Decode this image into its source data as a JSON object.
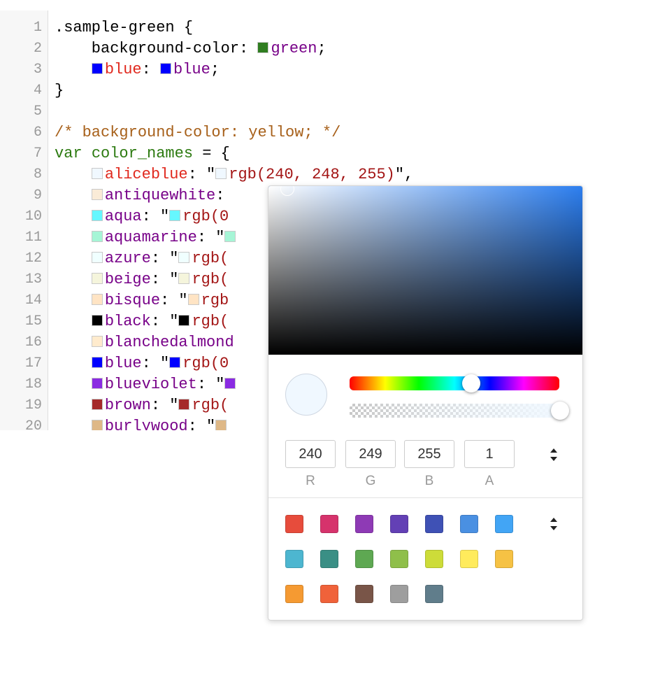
{
  "editor": {
    "lines": [
      {
        "n": "1",
        "toks": [
          {
            "t": ".sample-green",
            "c": "sel"
          },
          {
            "t": " {",
            "c": "pun"
          }
        ]
      },
      {
        "n": "2",
        "toks": [
          {
            "t": "    background-color: ",
            "c": "prop"
          },
          {
            "sw": "#2f7d20"
          },
          {
            "t": "green",
            "c": "val"
          },
          {
            "t": ";",
            "c": "pun"
          }
        ]
      },
      {
        "n": "3",
        "toks": [
          {
            "t": "    ",
            "c": "pun"
          },
          {
            "sw": "#0000ff"
          },
          {
            "t": "blue",
            "c": "err"
          },
          {
            "t": ": ",
            "c": "pun"
          },
          {
            "sw": "#0000ff"
          },
          {
            "t": "blue",
            "c": "val"
          },
          {
            "t": ";",
            "c": "pun"
          }
        ]
      },
      {
        "n": "4",
        "toks": [
          {
            "t": "}",
            "c": "pun"
          }
        ]
      },
      {
        "n": "5",
        "toks": []
      },
      {
        "n": "6",
        "toks": [
          {
            "t": "/* background-color: yellow; */",
            "c": "com"
          }
        ]
      },
      {
        "n": "7",
        "toks": [
          {
            "t": "var",
            "c": "kw"
          },
          {
            "t": " ",
            "c": "pun"
          },
          {
            "t": "color_names",
            "c": "var"
          },
          {
            "t": " = {",
            "c": "pun"
          }
        ]
      },
      {
        "n": "8",
        "toks": [
          {
            "t": "    ",
            "c": "pun"
          },
          {
            "sw": "#f0f8ff"
          },
          {
            "t": "aliceblue",
            "c": "err"
          },
          {
            "t": ": \"",
            "c": "pun"
          },
          {
            "sw": "#f0f8ff"
          },
          {
            "t": "rgb(240, 248, 255)",
            "c": "str"
          },
          {
            "t": "\",",
            "c": "pun"
          }
        ]
      },
      {
        "n": "9",
        "toks": [
          {
            "t": "    ",
            "c": "pun"
          },
          {
            "sw": "#faebd7"
          },
          {
            "t": "antiquewhite",
            "c": "key"
          },
          {
            "t": ": ",
            "c": "pun"
          }
        ]
      },
      {
        "n": "10",
        "toks": [
          {
            "t": "    ",
            "c": "pun"
          },
          {
            "sw": "#66f7ff"
          },
          {
            "t": "aqua",
            "c": "key"
          },
          {
            "t": ": \"",
            "c": "pun"
          },
          {
            "sw": "#66f7ff"
          },
          {
            "t": "rgb(0",
            "c": "str"
          }
        ]
      },
      {
        "n": "11",
        "toks": [
          {
            "t": "    ",
            "c": "pun"
          },
          {
            "sw": "#a6f5d6"
          },
          {
            "t": "aquamarine",
            "c": "key"
          },
          {
            "t": ": \"",
            "c": "pun"
          },
          {
            "sw": "#a6f5d6"
          }
        ]
      },
      {
        "n": "12",
        "toks": [
          {
            "t": "    ",
            "c": "pun"
          },
          {
            "sw": "#f0ffff"
          },
          {
            "t": "azure",
            "c": "key"
          },
          {
            "t": ": \"",
            "c": "pun"
          },
          {
            "sw": "#f0ffff"
          },
          {
            "t": "rgb(",
            "c": "str"
          }
        ]
      },
      {
        "n": "13",
        "toks": [
          {
            "t": "    ",
            "c": "pun"
          },
          {
            "sw": "#f5f5dc"
          },
          {
            "t": "beige",
            "c": "key"
          },
          {
            "t": ": \"",
            "c": "pun"
          },
          {
            "sw": "#f5f5dc"
          },
          {
            "t": "rgb(",
            "c": "str"
          }
        ]
      },
      {
        "n": "14",
        "toks": [
          {
            "t": "    ",
            "c": "pun"
          },
          {
            "sw": "#ffe4c4"
          },
          {
            "t": "bisque",
            "c": "key"
          },
          {
            "t": ": \"",
            "c": "pun"
          },
          {
            "sw": "#ffe4c4"
          },
          {
            "t": "rgb",
            "c": "str"
          }
        ]
      },
      {
        "n": "15",
        "toks": [
          {
            "t": "    ",
            "c": "pun"
          },
          {
            "sw": "#000000"
          },
          {
            "t": "black",
            "c": "key"
          },
          {
            "t": ": \"",
            "c": "pun"
          },
          {
            "sw": "#000000"
          },
          {
            "t": "rgb(",
            "c": "str"
          }
        ]
      },
      {
        "n": "16",
        "toks": [
          {
            "t": "    ",
            "c": "pun"
          },
          {
            "sw": "#ffebcd"
          },
          {
            "t": "blanchedalmond",
            "c": "key"
          }
        ]
      },
      {
        "n": "17",
        "toks": [
          {
            "t": "    ",
            "c": "pun"
          },
          {
            "sw": "#0000ff"
          },
          {
            "t": "blue",
            "c": "key"
          },
          {
            "t": ": \"",
            "c": "pun"
          },
          {
            "sw": "#0000ff"
          },
          {
            "t": "rgb(0",
            "c": "str"
          }
        ]
      },
      {
        "n": "18",
        "toks": [
          {
            "t": "    ",
            "c": "pun"
          },
          {
            "sw": "#8a2be2"
          },
          {
            "t": "blueviolet",
            "c": "key"
          },
          {
            "t": ": \"",
            "c": "pun"
          },
          {
            "sw": "#8a2be2"
          }
        ]
      },
      {
        "n": "19",
        "toks": [
          {
            "t": "    ",
            "c": "pun"
          },
          {
            "sw": "#a52a2a"
          },
          {
            "t": "brown",
            "c": "key"
          },
          {
            "t": ": \"",
            "c": "pun"
          },
          {
            "sw": "#a52a2a"
          },
          {
            "t": "rgb(",
            "c": "str"
          }
        ]
      },
      {
        "n": "20",
        "toks": [
          {
            "t": "    ",
            "c": "pun"
          },
          {
            "sw": "#deb887"
          },
          {
            "t": "burlywood",
            "c": "key"
          },
          {
            "t": ": \"",
            "c": "pun"
          },
          {
            "sw": "#deb887"
          }
        ]
      }
    ]
  },
  "picker": {
    "sv_hue_color": "#2d7ff0",
    "current_color": "#f0f8ff",
    "hue_fraction": 0.58,
    "alpha": 1,
    "inputs": [
      {
        "value": "240",
        "label": "R"
      },
      {
        "value": "249",
        "label": "G"
      },
      {
        "value": "255",
        "label": "B"
      },
      {
        "value": "1",
        "label": "A"
      }
    ],
    "mode_toggle_icon": "up-down-arrows-icon",
    "palette_toggle_icon": "up-down-arrows-icon",
    "presets": [
      [
        "#e74c3c",
        "#d6336c",
        "#8e3ab5",
        "#6340b5",
        "#3f51b5",
        "#4a90e2",
        "#42a5f5"
      ],
      [
        "#4db6d0",
        "#3a8f85",
        "#5ea852",
        "#8fbf4a",
        "#cddc39",
        "#ffeb5c",
        "#f6c244"
      ],
      [
        "#f59a32",
        "#f0623a",
        "#795548",
        "#9e9e9e",
        "#607d8b"
      ]
    ]
  }
}
